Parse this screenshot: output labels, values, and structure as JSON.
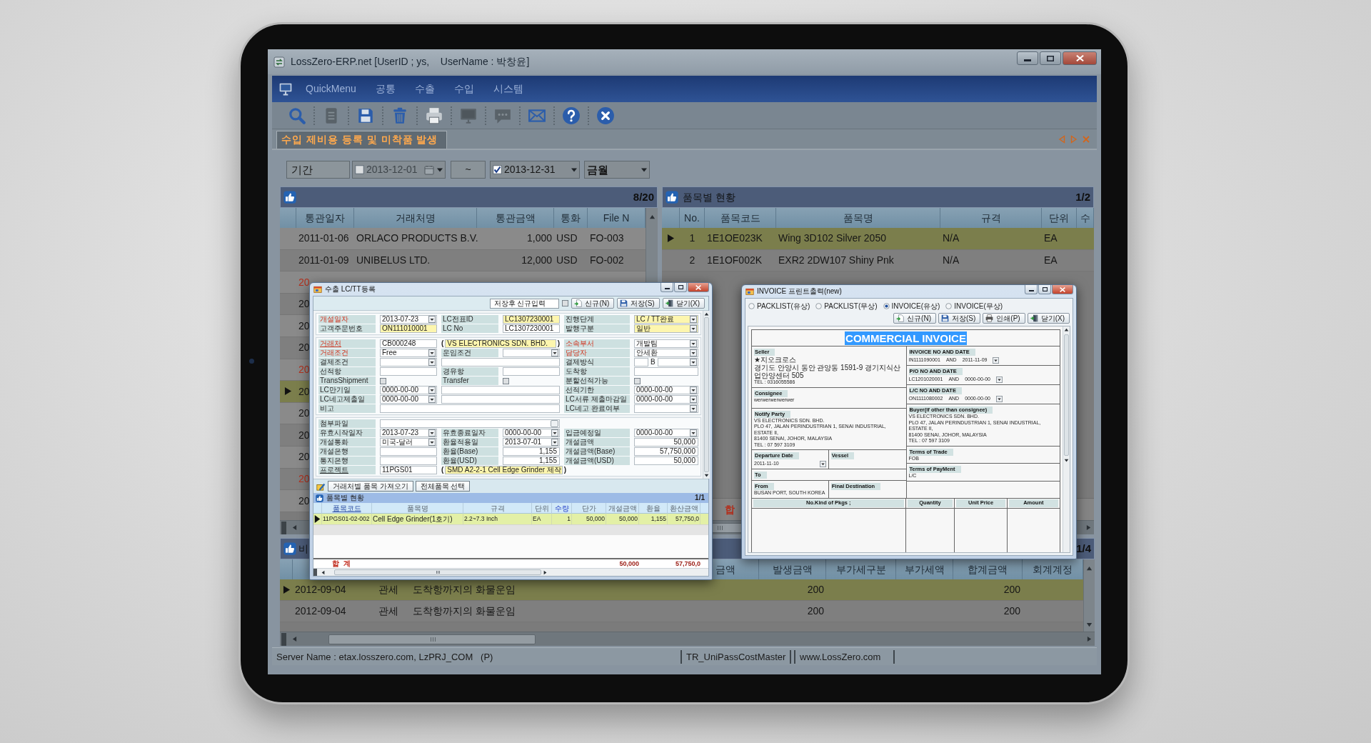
{
  "window": {
    "title": "LossZero-ERP.net [UserID ; ys,    UserName : 박창윤]"
  },
  "menu": [
    "QuickMenu",
    "공통",
    "수출",
    "수입",
    "시스템"
  ],
  "toolbar": [
    {
      "kind": "search",
      "disabled": false
    },
    {
      "kind": "document",
      "disabled": true
    },
    {
      "kind": "save",
      "disabled": false
    },
    {
      "kind": "delete",
      "disabled": false
    },
    {
      "kind": "print",
      "disabled": false
    },
    {
      "kind": "monitor",
      "disabled": true
    },
    {
      "kind": "chat",
      "disabled": true
    },
    {
      "kind": "mail",
      "disabled": false
    },
    {
      "kind": "help",
      "disabled": false
    },
    {
      "kind": "close",
      "disabled": false
    }
  ],
  "tab": {
    "label": "수입 제비용 등록 및 미착품 발생"
  },
  "filter": {
    "label": "기간",
    "from": {
      "value": "2013-12-01",
      "checked": false
    },
    "separator": "~",
    "to": {
      "value": "2013-12-31",
      "checked": true
    },
    "period": "금월"
  },
  "left_grid": {
    "count": "8/20",
    "columns": [
      "통관일자",
      "거래처명",
      "통관금액",
      "통화",
      "File N"
    ],
    "rows": [
      {
        "cells": [
          "2011-01-06",
          "ORLACO PRODUCTS B.V.",
          "1,000",
          "USD",
          "FO-003"
        ],
        "selected": false,
        "color": "#161616"
      },
      {
        "cells": [
          "2011-01-09",
          "UNIBELUS LTD.",
          "12,000",
          "USD",
          "FO-002"
        ],
        "selected": false,
        "color": "#161616"
      },
      {
        "cells": [
          "20"
        ],
        "selected": false,
        "color": "#b3301d"
      },
      {
        "cells": [
          "20"
        ],
        "selected": false,
        "color": "#161616"
      },
      {
        "cells": [
          "20"
        ],
        "selected": false,
        "color": "#161616"
      },
      {
        "cells": [
          "20"
        ],
        "selected": false,
        "color": "#161616"
      },
      {
        "cells": [
          "20"
        ],
        "selected": false,
        "color": "#b3301d"
      },
      {
        "cells": [
          "20"
        ],
        "selected": true,
        "color": "#161616"
      },
      {
        "cells": [
          "20"
        ],
        "selected": false,
        "color": "#161616"
      },
      {
        "cells": [
          "20"
        ],
        "selected": false,
        "color": "#161616"
      },
      {
        "cells": [
          "20"
        ],
        "selected": false,
        "color": "#161616"
      },
      {
        "cells": [
          "20"
        ],
        "selected": false,
        "color": "#b3301d"
      },
      {
        "cells": [
          "20"
        ],
        "selected": false,
        "color": "#161616"
      }
    ]
  },
  "right_grid": {
    "title": "품목별 현황",
    "count": "1/2",
    "columns": [
      "No.",
      "품목코드",
      "품목명",
      "규격",
      "단위",
      "수"
    ],
    "rows": [
      {
        "cells": [
          "1",
          "1E1OE023K",
          "Wing 3D102 Silver 2050",
          "N/A",
          "EA"
        ],
        "selected": true
      },
      {
        "cells": [
          "2",
          "1E1OF002K",
          "EXR2 2DW107 Shiny Pnk",
          "N/A",
          "EA"
        ],
        "selected": false
      }
    ],
    "total": "합"
  },
  "bottom_grid": {
    "title": "비",
    "count": "1/4",
    "columns": [
      "금액",
      "발생금액",
      "부가세구분",
      "부가세액",
      "합계금액",
      "회계계정"
    ],
    "rows": [
      {
        "column_1": "2012-09-04",
        "column_2": "관세",
        "column_3": "도착항까지의 화물운임",
        "issued_amount": "200",
        "total_amount": "200",
        "selected": true
      },
      {
        "column_1": "2012-09-04",
        "column_2": "관세",
        "column_3": "도착항까지의 화물운임",
        "issued_amount": "200",
        "total_amount": "200",
        "selected": false
      }
    ]
  },
  "status_bar": [
    "Server Name : etax.losszero.com, LzPRJ_COM   (P)",
    "TR_UniPassCostMaster",
    "www.LossZero.com"
  ],
  "lc_dialog": {
    "title": "수출 LC/TT등록",
    "save_then_new": {
      "label": "저장후 신규입력",
      "checked": false
    },
    "buttons": [
      {
        "kind": "new",
        "label": "신규(N)"
      },
      {
        "kind": "save",
        "label": "저장(S)"
      },
      {
        "kind": "close",
        "label": "닫기(X)"
      }
    ],
    "sections": [
      [
        [
          {
            "kind": "label",
            "text": "개설일자",
            "required": true,
            "link": false
          },
          {
            "kind": "dropdown",
            "value": "2013-07-23",
            "highlighted": false
          },
          {
            "kind": "label",
            "text": "LC전표ID",
            "required": false,
            "link": false
          },
          {
            "kind": "text",
            "value": "LC1307230001",
            "highlighted": true
          },
          {
            "kind": "label",
            "text": "진행단계",
            "required": false,
            "link": false
          },
          {
            "kind": "dropdown",
            "value": "LC / TT완료",
            "highlighted": true
          }
        ],
        [
          {
            "kind": "label",
            "text": "고객주문번호",
            "required": false,
            "link": false
          },
          {
            "kind": "text",
            "value": "ON111010001",
            "highlighted": true
          },
          {
            "kind": "label",
            "text": "LC No",
            "required": false,
            "link": false
          },
          {
            "kind": "text",
            "value": "LC1307230001",
            "highlighted": false
          },
          {
            "kind": "label",
            "text": "발행구분",
            "required": false,
            "link": false
          },
          {
            "kind": "dropdown",
            "value": "일반",
            "highlighted": true
          }
        ]
      ],
      [
        [
          {
            "kind": "label",
            "text": "거래처",
            "required": true,
            "link": true
          },
          {
            "kind": "text",
            "value": "CB000248",
            "highlighted": false
          },
          {
            "kind": "ref",
            "open": "(",
            "value": "VS ELECTRONICS SDN. BHD.",
            "close": ")",
            "highlighted": true
          },
          {
            "kind": "label",
            "text": "소속부서",
            "required": true,
            "link": false
          },
          {
            "kind": "dropdown",
            "value": "개발팀",
            "highlighted": false
          }
        ],
        [
          {
            "kind": "label",
            "text": "거래조건",
            "required": true,
            "link": false
          },
          {
            "kind": "dropdown",
            "value": "Free",
            "highlighted": false
          },
          {
            "kind": "label",
            "text": "운임조건",
            "required": false,
            "link": false
          },
          {
            "kind": "dropdown",
            "highlighted": false
          },
          {
            "kind": "label",
            "text": "담당자",
            "required": true,
            "link": false
          },
          {
            "kind": "dropdown",
            "value": "안세환",
            "highlighted": false
          }
        ],
        [
          {
            "kind": "label",
            "text": "결제조건",
            "required": false,
            "link": false
          },
          {
            "kind": "dropdown",
            "highlighted": false
          },
          {
            "kind": "wide"
          },
          {
            "kind": "label",
            "text": "결제방식",
            "required": false,
            "link": false
          },
          {
            "kind": "split",
            "mid": "B"
          }
        ],
        [
          {
            "kind": "label",
            "text": "선적항",
            "required": false,
            "link": false
          },
          {
            "kind": "text",
            "highlighted": false
          },
          {
            "kind": "label",
            "text": "경유항",
            "required": false,
            "link": false
          },
          {
            "kind": "text",
            "highlighted": false
          },
          {
            "kind": "label",
            "text": "도착항",
            "required": false,
            "link": false
          },
          {
            "kind": "text",
            "highlighted": false
          }
        ],
        [
          {
            "kind": "label",
            "text": "TransShipment",
            "required": false,
            "link": false
          },
          {
            "kind": "checkbox",
            "checked": false
          },
          {
            "kind": "label",
            "text": "Transfer",
            "required": false,
            "link": false
          },
          {
            "kind": "checkbox",
            "checked": false
          },
          {
            "kind": "label",
            "text": "분할선적가능",
            "required": false,
            "link": false
          },
          {
            "kind": "checkbox",
            "checked": false
          }
        ],
        [
          {
            "kind": "label",
            "text": "LC만기일",
            "required": false,
            "link": false
          },
          {
            "kind": "dropdown",
            "value": "0000-00-00",
            "highlighted": false
          },
          {
            "kind": "wide"
          },
          {
            "kind": "label",
            "text": "선적기한",
            "required": false,
            "link": false
          },
          {
            "kind": "dropdown",
            "value": "0000-00-00",
            "highlighted": false
          }
        ],
        [
          {
            "kind": "label",
            "text": "LC네고제출일",
            "required": false,
            "link": false
          },
          {
            "kind": "dropdown",
            "value": "0000-00-00",
            "highlighted": false
          },
          {
            "kind": "wide"
          },
          {
            "kind": "label",
            "text": "LC서류 제출마감일",
            "required": false,
            "link": false
          },
          {
            "kind": "dropdown",
            "value": "0000-00-00",
            "highlighted": false
          }
        ],
        [
          {
            "kind": "label",
            "text": "비고",
            "required": false,
            "link": false
          },
          {
            "kind": "full"
          },
          {
            "kind": "label",
            "text": "LC네고 완료여부",
            "required": false,
            "link": false
          },
          {
            "kind": "dropdown",
            "highlighted": false
          }
        ]
      ],
      [
        [
          {
            "kind": "label",
            "text": "첨부파일",
            "required": false,
            "link": false
          },
          {
            "kind": "file"
          }
        ],
        [
          {
            "kind": "label",
            "text": "유효시작일자",
            "required": false,
            "link": false
          },
          {
            "kind": "dropdown",
            "value": "2013-07-23",
            "highlighted": false
          },
          {
            "kind": "label",
            "text": "유효종료일자",
            "required": false,
            "link": false
          },
          {
            "kind": "dropdown",
            "value": "0000-00-00",
            "highlighted": false
          },
          {
            "kind": "label",
            "text": "입금예정일",
            "required": false,
            "link": false
          },
          {
            "kind": "dropdown",
            "value": "0000-00-00",
            "highlighted": false
          }
        ],
        [
          {
            "kind": "label",
            "text": "개설통화",
            "required": false,
            "link": false
          },
          {
            "kind": "dropdown",
            "value": "미국-달러",
            "highlighted": false
          },
          {
            "kind": "label",
            "text": "환율적용일",
            "required": false,
            "link": false
          },
          {
            "kind": "dropdown",
            "value": "2013-07-01",
            "highlighted": false
          },
          {
            "kind": "label",
            "text": "개설금액",
            "required": false,
            "link": false
          },
          {
            "kind": "amount",
            "value": "50,000",
            "highlighted": false
          }
        ],
        [
          {
            "kind": "label",
            "text": "개설은행",
            "required": false,
            "link": false
          },
          {
            "kind": "text",
            "highlighted": false
          },
          {
            "kind": "label",
            "text": "환율(Base)",
            "required": false,
            "link": false
          },
          {
            "kind": "amount",
            "value": "1,155",
            "highlighted": false
          },
          {
            "kind": "label",
            "text": "개설금액(Base)",
            "required": false,
            "link": false
          },
          {
            "kind": "amount",
            "value": "57,750,000",
            "highlighted": false
          }
        ],
        [
          {
            "kind": "label",
            "text": "통지은행",
            "required": false,
            "link": false
          },
          {
            "kind": "text",
            "highlighted": false
          },
          {
            "kind": "label",
            "text": "환율(USD)",
            "required": false,
            "link": false
          },
          {
            "kind": "amount",
            "value": "1,155",
            "highlighted": false
          },
          {
            "kind": "label",
            "text": "개설금액(USD)",
            "required": false,
            "link": false
          },
          {
            "kind": "amount",
            "value": "50,000",
            "highlighted": false
          }
        ],
        [
          {
            "kind": "label",
            "text": "프로젝트",
            "required": false,
            "link": true
          },
          {
            "kind": "text",
            "value": "11PGS01",
            "highlighted": false
          },
          {
            "kind": "ref",
            "open": "(",
            "value": "SMD A2-2-1 Cell Edge Grinder 제작",
            "close": ")",
            "highlighted": true
          }
        ]
      ]
    ],
    "actions": [
      "거래처별 품목 가져오기",
      "전체품목 선택"
    ],
    "items": {
      "title": "품목별 현황",
      "count": "1/1",
      "columns": [
        {
          "label": "품목코드",
          "kind": "link"
        },
        {
          "label": "품목명",
          "kind": "plain"
        },
        {
          "label": "규격",
          "kind": "plain"
        },
        {
          "label": "단위",
          "kind": "plain"
        },
        {
          "label": "수량",
          "kind": "editable"
        },
        {
          "label": "단가",
          "kind": "plain"
        },
        {
          "label": "개설금액",
          "kind": "plain"
        },
        {
          "label": "환율",
          "kind": "plain"
        },
        {
          "label": "환산금액",
          "kind": "plain"
        }
      ],
      "rows": [
        {
          "cells": [
            "11PGS01-02-002",
            "Cell Edge Grinder(1호기)",
            "2.2~7.3 Inch",
            "EA",
            "1",
            "50,000",
            "50,000",
            "1,155",
            "57,750,0"
          ],
          "selected": true
        }
      ],
      "total": {
        "label": "합  계",
        "amount": "50,000",
        "converted": "57,750,0"
      }
    }
  },
  "invoice_dialog": {
    "title": "INVOICE 프린트출력(new)",
    "options": [
      {
        "label": "PACKLIST(유상)",
        "selected": false
      },
      {
        "label": "PACKLIST(무상)",
        "selected": false
      },
      {
        "label": "INVOICE(유상)",
        "selected": true
      },
      {
        "label": "INVOICE(무상)",
        "selected": false
      }
    ],
    "buttons": [
      {
        "kind": "new",
        "label": "신규(N)"
      },
      {
        "kind": "save",
        "label": "저장(S)"
      },
      {
        "kind": "print",
        "label": "인쇄(P)"
      },
      {
        "kind": "close",
        "label": "닫기(X)"
      }
    ],
    "document": {
      "heading": "COMMERCIAL INVOICE",
      "seller": {
        "label": "Seller",
        "lines": [
          "★지오크로스",
          "경기도 안양시 동안 관양동 1591-9 경기지식산업안양센터 505",
          "TEL : 0316055586"
        ]
      },
      "consignee": {
        "label": "Consignee",
        "lines": [
          "werwerwerwerwer"
        ]
      },
      "notify_party": {
        "label": "Notify Party",
        "lines": [
          "VS ELECTRONICS SDN. BHD.",
          "PLO 47, JALAN PERINDUSTRIAN 1, SENAI INDUSTRIAL,  ESTATE II,",
          "81400 SENAI, JOHOR, MALAYSIA",
          "TEL : 07 597 3109"
        ]
      },
      "departure_date": {
        "label": "Departure Date",
        "value": "2011-11-10"
      },
      "vessel": {
        "label": "Vessel"
      },
      "to": {
        "label": "To"
      },
      "from": {
        "label": "From",
        "lines": [
          "BUSAN PORT, SOUTH KOREA"
        ]
      },
      "final_destination": {
        "label": "Final Destination"
      },
      "invoice_no": {
        "label": "INVOICE NO AND DATE",
        "number": "IN1111090001",
        "joiner": "AND",
        "date": "2011-11-09"
      },
      "po_no": {
        "label": "P/O NO AND DATE",
        "number": "LC1201020001",
        "joiner": "AND",
        "date": "0000-00-00"
      },
      "lc_no": {
        "label": "L/C NO AND DATE",
        "number": "ON1111080002",
        "joiner": "AND",
        "date": "0000-00-00"
      },
      "buyer": {
        "label": "Buyer(if other than consignee)",
        "lines": [
          "VS ELECTRONICS SDN. BHD.",
          "PLO 47, JALAN PERINDUSTRIAN 1, SENAI INDUSTRIAL,  ESTATE II,",
          "81400 SENAI, JOHOR, MALAYSIA",
          "TEL : 07 597 3109"
        ]
      },
      "terms_of_trade": {
        "label": "Terms of Trade",
        "lines": [
          "FOB"
        ]
      },
      "terms_of_payment": {
        "label": "Terms of PayMent",
        "lines": [
          "L/C"
        ]
      },
      "columns": [
        "No.Kind of Pkgs ;",
        "Quantity",
        "Unit Price",
        "Amount"
      ]
    }
  }
}
